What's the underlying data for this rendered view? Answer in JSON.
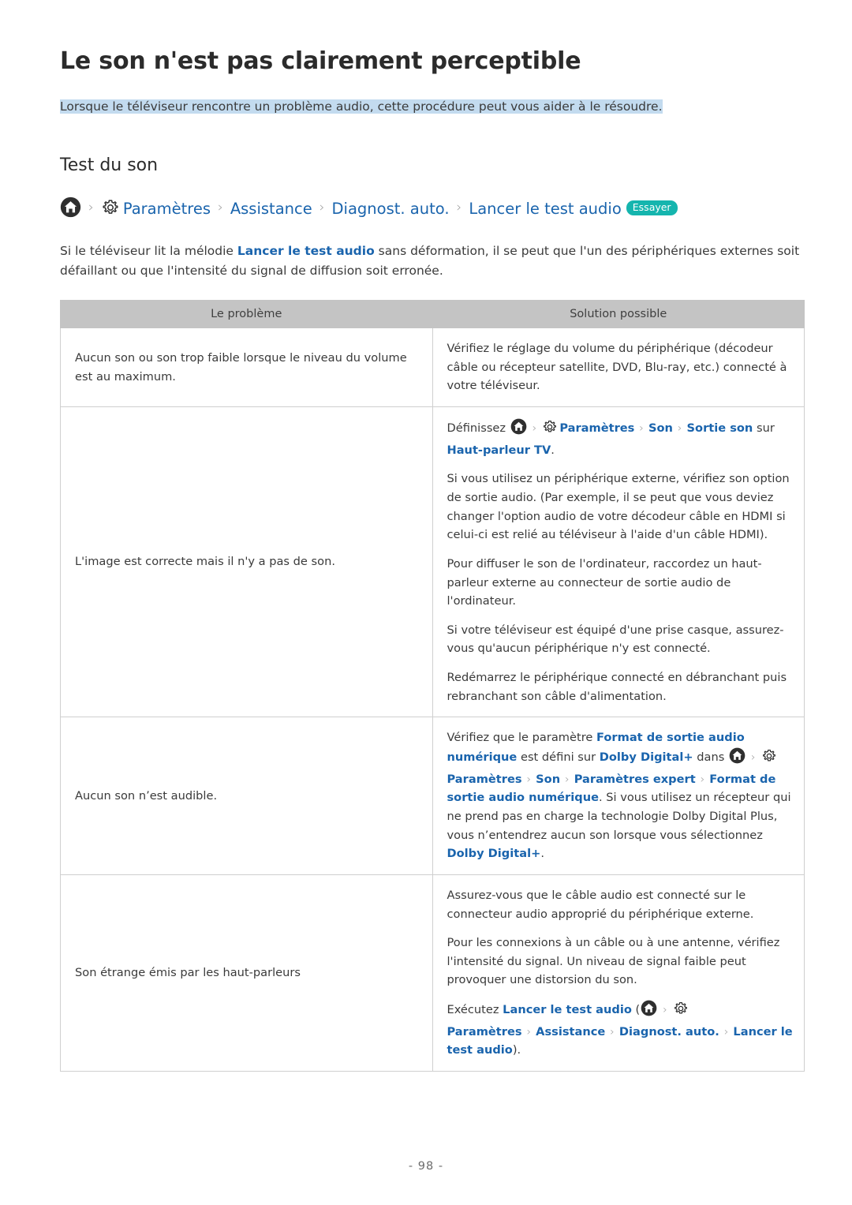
{
  "page": {
    "title": "Le son n'est pas clairement perceptible",
    "subtitle": "Lorsque le téléviseur rencontre un problème audio, cette procédure peut vous aider à le résoudre.",
    "section_heading": "Test du son",
    "page_number": "- 98 -",
    "highlight_color": "#c3dbef",
    "link_color": "#1a64ad",
    "badge_color": "#15b5ae",
    "table_header_color": "#c4c4c4"
  },
  "breadcrumb": {
    "home_icon": "home-icon",
    "gear_icon": "gear-icon",
    "separator": "›",
    "items": [
      {
        "label": "Paramètres"
      },
      {
        "label": "Assistance"
      },
      {
        "label": "Diagnost. auto."
      },
      {
        "label": "Lancer le test audio"
      }
    ],
    "badge": "Essayer"
  },
  "intro": {
    "part1": "Si le téléviseur lit la mélodie ",
    "link1": "Lancer le test audio",
    "part2": " sans déformation, il se peut que l'un des périphériques externes soit défaillant ou que l'intensité du signal de diffusion soit erronée."
  },
  "table": {
    "headers": [
      "Le problème",
      "Solution possible"
    ],
    "rows": [
      {
        "problem": "Aucun son ou son trop faible lorsque le niveau du volume est au maximum.",
        "solution": [
          {
            "segments": [
              {
                "t": "Vérifiez le réglage du volume du périphérique (décodeur câble ou récepteur satellite, DVD, Blu-ray, etc.) connecté à votre téléviseur.",
                "s": "plain"
              }
            ]
          }
        ]
      },
      {
        "problem": "L'image est correcte mais il n'y a pas de son.",
        "solution": [
          {
            "segments": [
              {
                "t": "Définissez ",
                "s": "plain"
              },
              {
                "t": "home-icon",
                "s": "icon-home"
              },
              {
                "t": "›",
                "s": "sep"
              },
              {
                "t": "gear-icon",
                "s": "icon-gear"
              },
              {
                "t": "Paramètres",
                "s": "link"
              },
              {
                "t": "›",
                "s": "sep"
              },
              {
                "t": "Son",
                "s": "link"
              },
              {
                "t": "›",
                "s": "sep"
              },
              {
                "t": "Sortie son",
                "s": "link"
              },
              {
                "t": " sur ",
                "s": "plain"
              },
              {
                "t": "Haut-parleur TV",
                "s": "link"
              },
              {
                "t": ".",
                "s": "plain"
              }
            ]
          },
          {
            "segments": [
              {
                "t": "Si vous utilisez un périphérique externe, vérifiez son option de sortie audio. (Par exemple, il se peut que vous deviez changer l'option audio de votre décodeur câble en HDMI si celui-ci est relié au téléviseur à l'aide d'un câble HDMI).",
                "s": "plain"
              }
            ]
          },
          {
            "segments": [
              {
                "t": "Pour diffuser le son de l'ordinateur, raccordez un haut-parleur externe au connecteur de sortie audio de l'ordinateur.",
                "s": "plain"
              }
            ]
          },
          {
            "segments": [
              {
                "t": "Si votre téléviseur est équipé d'une prise casque, assurez-vous qu'aucun périphérique n'y est connecté.",
                "s": "plain"
              }
            ]
          },
          {
            "segments": [
              {
                "t": "Redémarrez le périphérique connecté en débranchant puis rebranchant son câble d'alimentation.",
                "s": "plain"
              }
            ]
          }
        ]
      },
      {
        "problem": "Aucun son n’est audible.",
        "solution": [
          {
            "segments": [
              {
                "t": "Vérifiez que le paramètre ",
                "s": "plain"
              },
              {
                "t": "Format de sortie audio numérique",
                "s": "link"
              },
              {
                "t": " est défini sur ",
                "s": "plain"
              },
              {
                "t": "Dolby Digital+",
                "s": "link"
              },
              {
                "t": " dans ",
                "s": "plain"
              },
              {
                "t": "home-icon",
                "s": "icon-home"
              },
              {
                "t": "›",
                "s": "sep"
              },
              {
                "t": "gear-icon",
                "s": "icon-gear"
              },
              {
                "t": "Paramètres",
                "s": "link"
              },
              {
                "t": "›",
                "s": "sep"
              },
              {
                "t": "Son",
                "s": "link"
              },
              {
                "t": "›",
                "s": "sep"
              },
              {
                "t": "Paramètres expert",
                "s": "link"
              },
              {
                "t": "›",
                "s": "sep"
              },
              {
                "t": "Format de sortie audio numérique",
                "s": "link"
              },
              {
                "t": ". Si vous utilisez un récepteur qui ne prend pas en charge la technologie Dolby Digital Plus, vous n’entendrez aucun son lorsque vous sélectionnez ",
                "s": "plain"
              },
              {
                "t": "Dolby Digital+",
                "s": "link"
              },
              {
                "t": ".",
                "s": "plain"
              }
            ]
          }
        ]
      },
      {
        "problem": "Son étrange émis par les haut-parleurs",
        "solution": [
          {
            "segments": [
              {
                "t": "Assurez-vous que le câble audio est connecté sur le connecteur audio approprié du périphérique externe.",
                "s": "plain"
              }
            ]
          },
          {
            "segments": [
              {
                "t": "Pour les connexions à un câble ou à une antenne, vérifiez l'intensité du signal. Un niveau de signal faible peut provoquer une distorsion du son.",
                "s": "plain"
              }
            ]
          },
          {
            "segments": [
              {
                "t": "Exécutez ",
                "s": "plain"
              },
              {
                "t": "Lancer le test audio",
                "s": "link"
              },
              {
                "t": " (",
                "s": "plain"
              },
              {
                "t": "home-icon",
                "s": "icon-home"
              },
              {
                "t": "›",
                "s": "sep"
              },
              {
                "t": "gear-icon",
                "s": "icon-gear"
              },
              {
                "t": "Paramètres",
                "s": "link"
              },
              {
                "t": "›",
                "s": "sep"
              },
              {
                "t": "Assistance",
                "s": "link"
              },
              {
                "t": "›",
                "s": "sep"
              },
              {
                "t": "Diagnost. auto.",
                "s": "link"
              },
              {
                "t": "›",
                "s": "sep"
              },
              {
                "t": "Lancer le test audio",
                "s": "link"
              },
              {
                "t": ").",
                "s": "plain"
              }
            ]
          }
        ]
      }
    ]
  }
}
